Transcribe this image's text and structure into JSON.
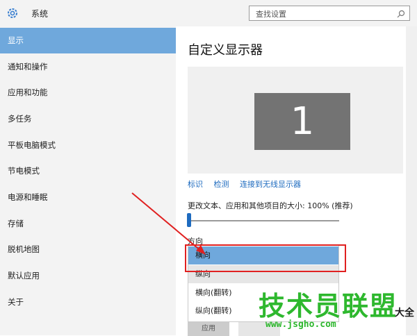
{
  "window": {
    "title": "系统"
  },
  "search": {
    "placeholder": "查找设置"
  },
  "sidebar": {
    "items": [
      {
        "label": "显示"
      },
      {
        "label": "通知和操作"
      },
      {
        "label": "应用和功能"
      },
      {
        "label": "多任务"
      },
      {
        "label": "平板电脑模式"
      },
      {
        "label": "节电模式"
      },
      {
        "label": "电源和睡眠"
      },
      {
        "label": "存储"
      },
      {
        "label": "脱机地图"
      },
      {
        "label": "默认应用"
      },
      {
        "label": "关于"
      }
    ],
    "selected_index": 0
  },
  "main": {
    "heading": "自定义显示器",
    "monitor_number": "1",
    "links": {
      "identify": "标识",
      "detect": "检测",
      "wireless": "连接到无线显示器"
    },
    "scale_label": "更改文本、应用和其他项目的大小: 100% (推荐)",
    "scale_value_percent": 100,
    "orientation_label": "方向",
    "orientation_options": [
      {
        "label": "横向"
      },
      {
        "label": "纵向"
      },
      {
        "label": "横向(翻转)"
      },
      {
        "label": "纵向(翻转)"
      }
    ],
    "orientation_selected": "横向",
    "apply_label": "应用"
  },
  "watermark": {
    "brand": "技术员联盟",
    "suffix": "大全",
    "url": "www.jsgho.com"
  },
  "colors": {
    "accent": "#6fa8dc",
    "link": "#1e6bbf",
    "annotation": "#e02020",
    "watermark": "#2eb82e"
  }
}
